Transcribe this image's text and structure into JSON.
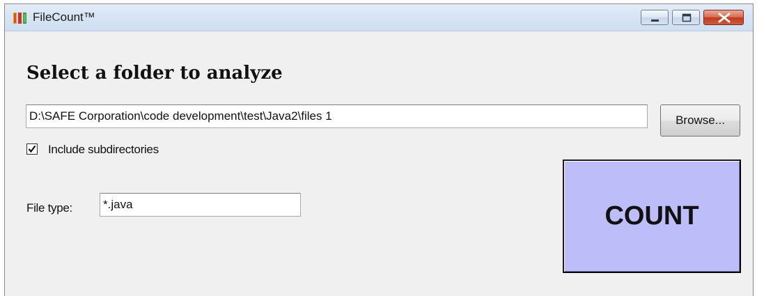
{
  "window": {
    "title": "FileCount™",
    "controls": {
      "minimize_icon": "minimize-icon",
      "maximize_icon": "maximize-icon",
      "close_icon": "close-icon"
    }
  },
  "main": {
    "heading": "Select a folder to analyze",
    "folder_path": "D:\\SAFE Corporation\\code development\\test\\Java2\\files 1",
    "browse_label": "Browse...",
    "include_subdirectories": {
      "label": "Include subdirectories",
      "checked": true
    },
    "file_type": {
      "label": "File type:",
      "value": "*.java"
    },
    "count_label": "COUNT"
  },
  "colors": {
    "count_button_bg": "#bdbdf9",
    "titlebar": "#d7e4f3",
    "close_button": "#c0391b"
  }
}
